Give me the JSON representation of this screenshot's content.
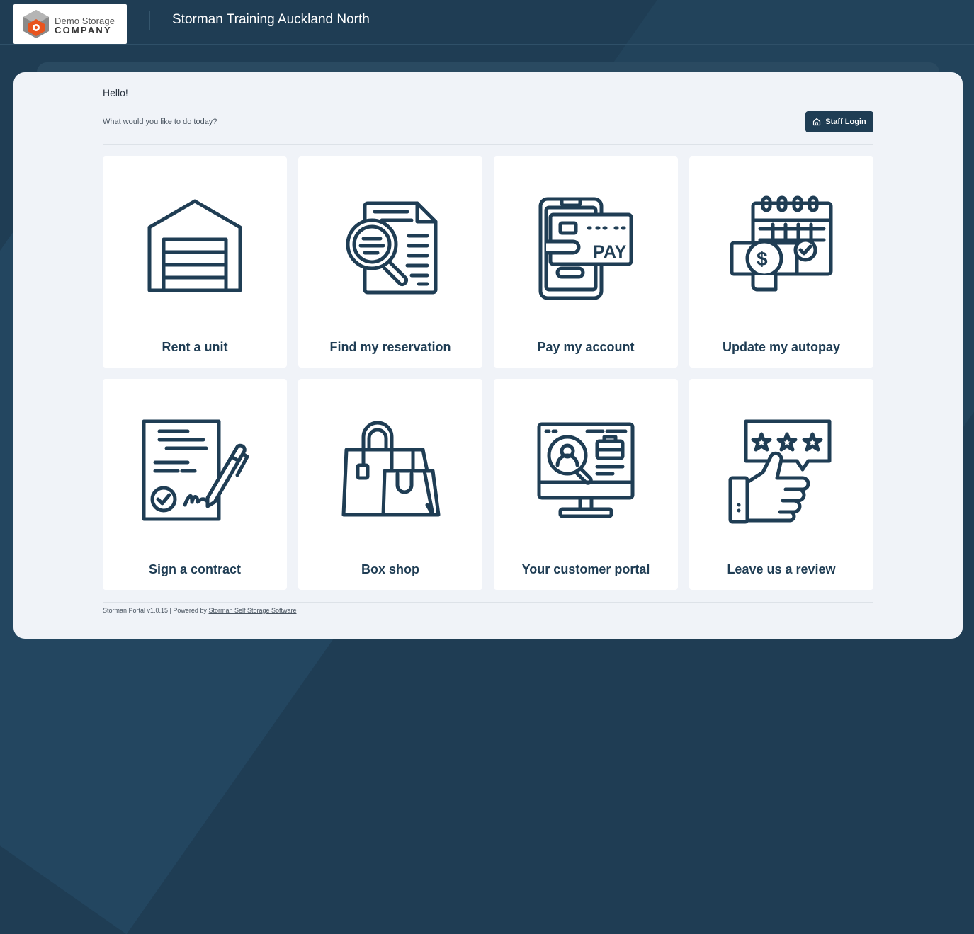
{
  "header": {
    "logo_line1": "Demo Storage",
    "logo_line2": "COMPANY",
    "site_title": "Storman Training Auckland North"
  },
  "main": {
    "greeting": "Hello!",
    "question": "What would you like to do today?",
    "staff_login_label": "Staff Login",
    "tiles": [
      {
        "label": "Rent a unit",
        "icon": "garage-icon"
      },
      {
        "label": "Find my reservation",
        "icon": "document-search-icon"
      },
      {
        "label": "Pay my account",
        "icon": "mobile-pay-icon"
      },
      {
        "label": "Update my autopay",
        "icon": "calendar-payment-icon"
      },
      {
        "label": "Sign a contract",
        "icon": "contract-sign-icon"
      },
      {
        "label": "Box shop",
        "icon": "shopping-bags-icon"
      },
      {
        "label": "Your customer portal",
        "icon": "computer-profile-icon"
      },
      {
        "label": "Leave us a review",
        "icon": "thumbs-up-review-icon"
      }
    ]
  },
  "footer": {
    "version_text": "Storman Portal v1.0.15 | Powered by",
    "link_text": "Storman Self Storage Software"
  },
  "colors": {
    "background": "#1f3d54",
    "card": "#f0f3f8",
    "accent": "#1f3d54",
    "logo_orange": "#e8541e"
  }
}
